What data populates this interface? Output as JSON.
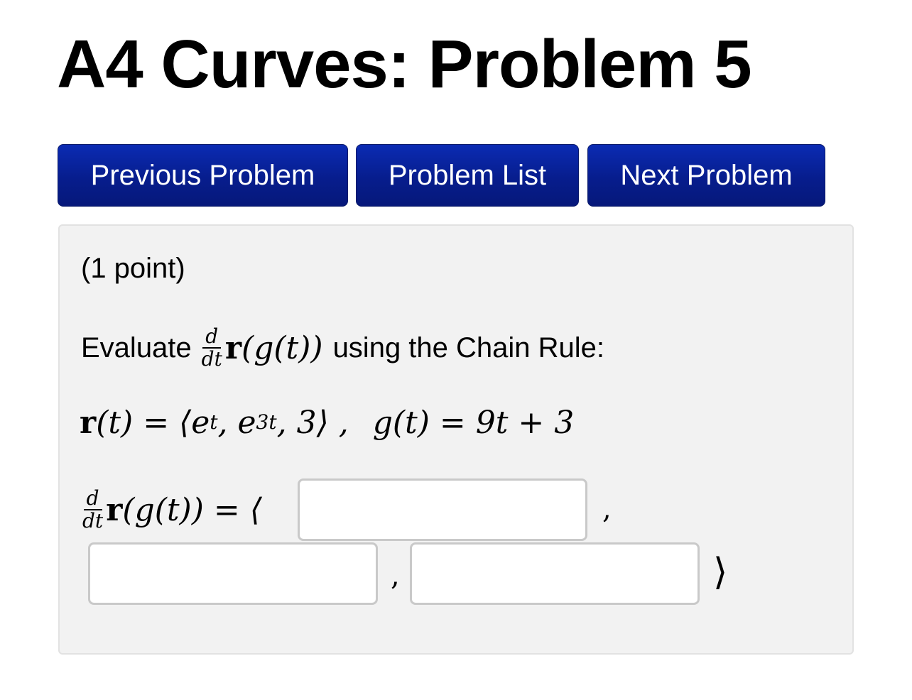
{
  "page": {
    "title": "A4 Curves: Problem 5"
  },
  "nav": {
    "previous_label": "Previous Problem",
    "list_label": "Problem List",
    "next_label": "Next Problem"
  },
  "problem": {
    "points": "(1 point)",
    "evaluate_prefix": "Evaluate",
    "evaluate_suffix": "using the Chain Rule:",
    "derivative_numerator": "d",
    "derivative_denominator": "dt",
    "r_symbol": "r",
    "composite_expression": "(g(t))",
    "r_definition": "(t) = ⟨e",
    "r_component_1_exponent": "t",
    "r_component_2_base": ", e",
    "r_component_2_exponent": "3t",
    "r_component_3": ", 3⟩ ,",
    "g_definition": "g(t) = 9t + 3",
    "answer_lhs_tail": "(g(t)) = ⟨",
    "answer_separator": ",",
    "answer_close": "⟩",
    "answers": [
      "",
      "",
      ""
    ]
  }
}
